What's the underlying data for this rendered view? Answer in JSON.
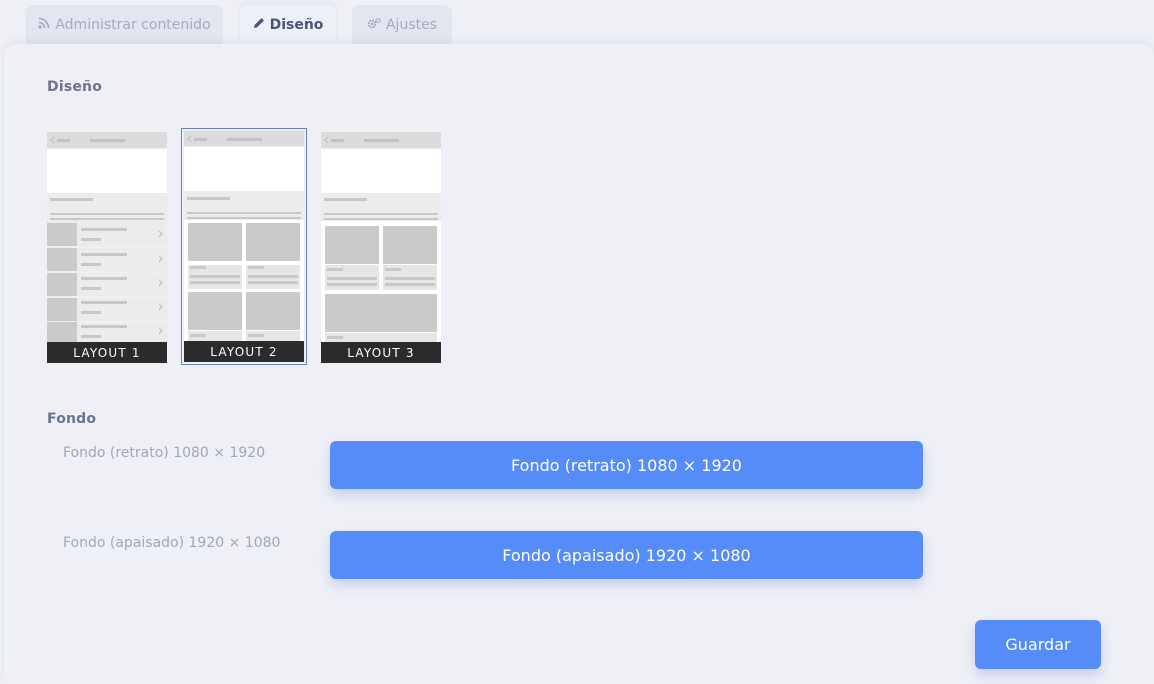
{
  "tabs": [
    {
      "label": "Administrar contenido",
      "icon": "rss-icon"
    },
    {
      "label": "Diseño",
      "icon": "pencil-icon",
      "active": true
    },
    {
      "label": "Ajustes",
      "icon": "cogs-icon"
    }
  ],
  "design": {
    "title": "Diseño",
    "layouts": [
      {
        "label": "LAYOUT 1"
      },
      {
        "label": "LAYOUT 2",
        "selected": true
      },
      {
        "label": "LAYOUT 3"
      }
    ]
  },
  "background": {
    "title": "Fondo",
    "portrait_label": "Fondo (retrato) 1080 × 1920",
    "portrait_button": "Fondo (retrato) 1080 × 1920",
    "landscape_label": "Fondo (apaisado) 1920 × 1080",
    "landscape_button": "Fondo (apaisado) 1920 × 1080"
  },
  "save_button": "Guardar",
  "colors": {
    "accent": "#558cf8",
    "background": "#eff0f6"
  }
}
